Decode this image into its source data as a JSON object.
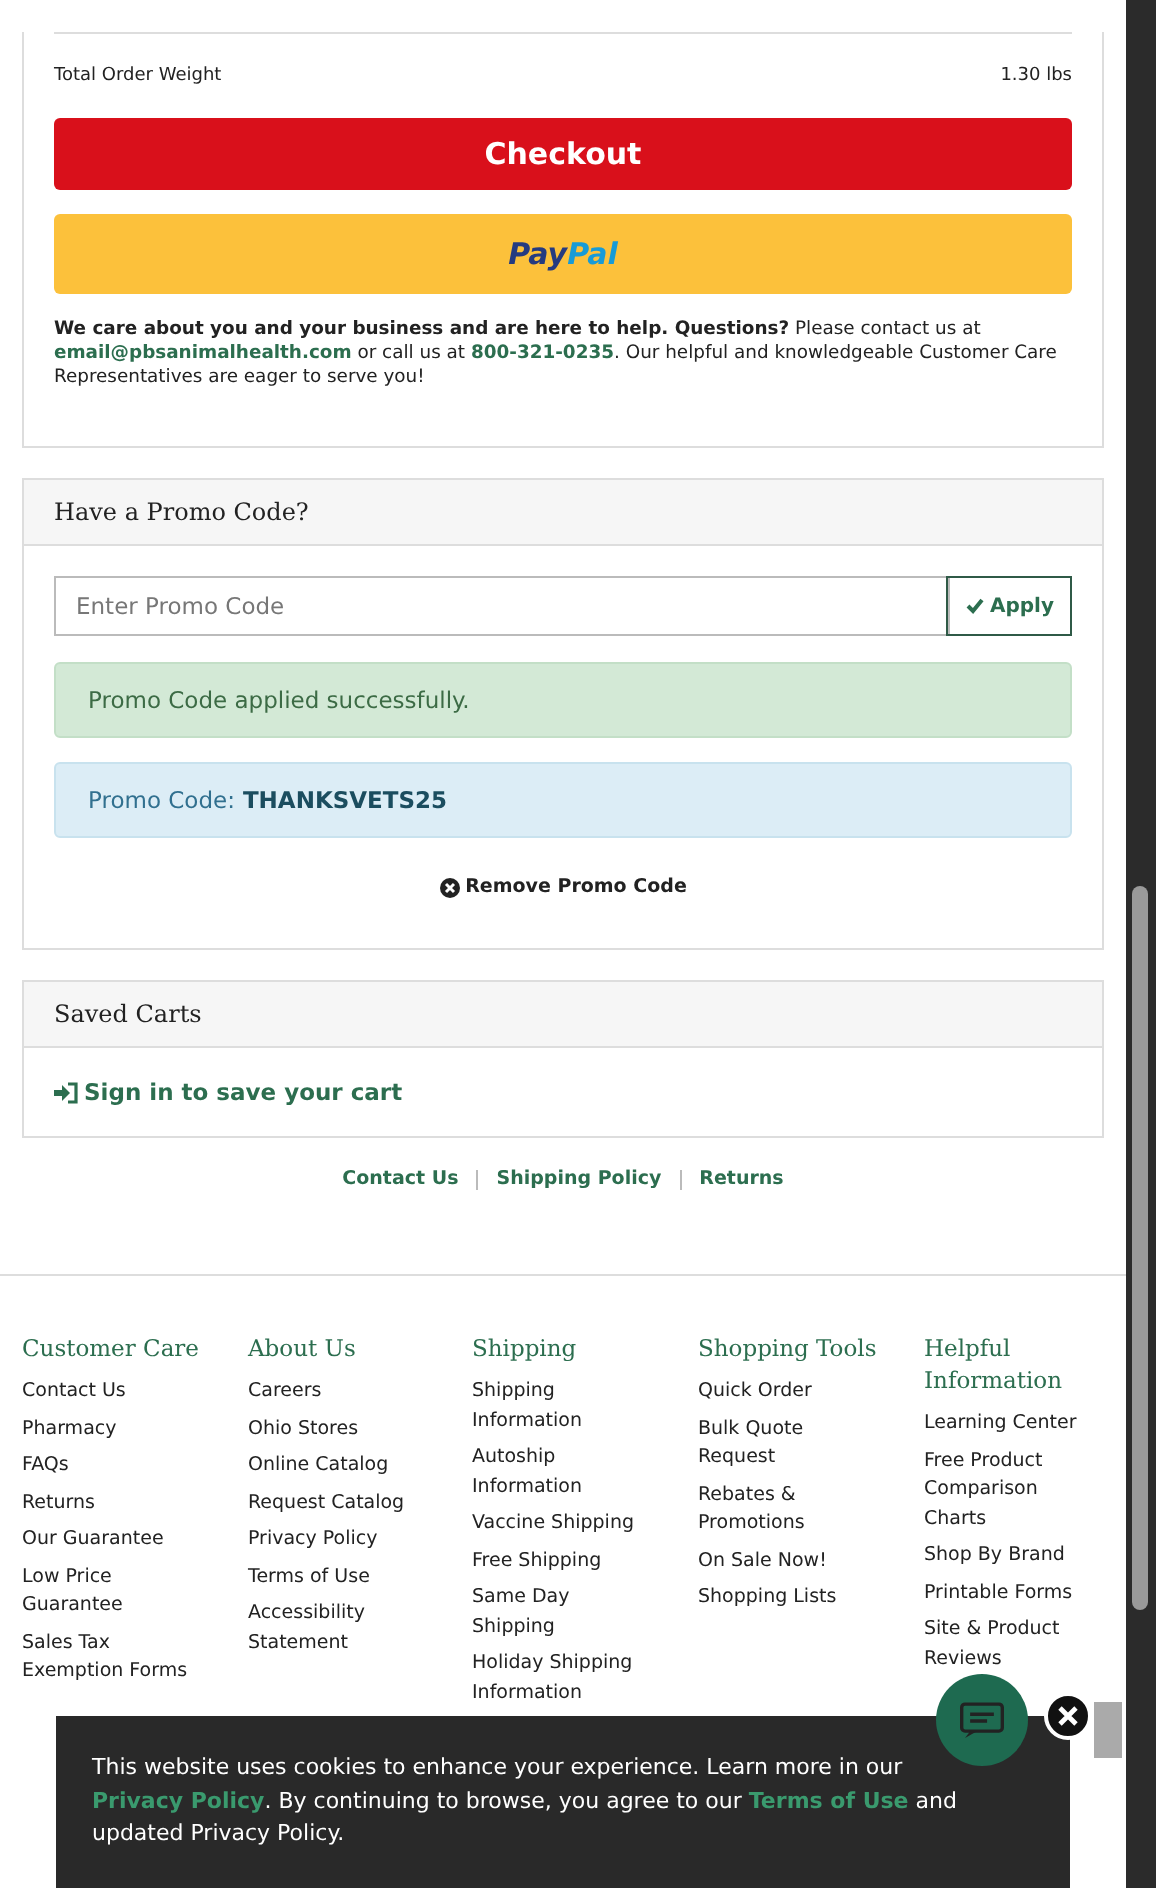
{
  "order_summary": {
    "weight_label": "Total Order Weight",
    "weight_value": "1.30 lbs",
    "checkout_button": "Checkout",
    "paypal_button": {
      "first": "Pay",
      "second": "Pal"
    },
    "help_text": "**We care about you and your business and are here to help. Questions?** Please contact us at",
    "help_email": "email@pbsanimalhealth.com",
    "help_mid": "or call us at",
    "help_phone": "800-321-0235",
    "help_tail": ". Our helpful and knowledgeable Customer Care Representatives are eager to serve you!"
  },
  "promo": {
    "title": "Have a Promo Code?",
    "placeholder": "Enter Promo Code",
    "apply_button": "Apply",
    "success_message": "Promo Code applied successfully.",
    "code_label": "Promo Code:",
    "code_value": "THANKSVETS25",
    "remove_link": "Remove Promo Code"
  },
  "saved_carts": {
    "title": "Saved Carts",
    "sign_in_link": "Sign in to save your cart"
  },
  "links": [
    "Contact Us",
    "Shipping Policy",
    "Returns"
  ],
  "footer_columns": [
    {
      "heading": "Customer Care",
      "items": [
        "Contact Us",
        "Pharmacy",
        "FAQs",
        "Returns",
        "Our Guarantee",
        "Low Price Guarantee",
        "Sales Tax Exemption Forms"
      ]
    },
    {
      "heading": "About Us",
      "items": [
        "Careers",
        "Ohio Stores",
        "Online Catalog",
        "Request Catalog",
        "Privacy Policy",
        "Terms of Use",
        "Accessibility Statement"
      ]
    },
    {
      "heading": "Shipping",
      "items": [
        "Shipping Information",
        "Autoship Information",
        "Vaccine Shipping",
        "Free Shipping",
        "Same Day Shipping",
        "Holiday Shipping Information"
      ]
    },
    {
      "heading": "Shopping Tools",
      "items": [
        "Quick Order",
        "Bulk Quote Request",
        "Rebates & Promotions",
        "On Sale Now!",
        "Shopping Lists"
      ]
    },
    {
      "heading": "Helpful Information",
      "items": [
        "Learning Center",
        "Free Product Comparison Charts",
        "Shop By Brand",
        "Printable Forms",
        "Site & Product Reviews"
      ]
    }
  ],
  "cookie_banner": {
    "text_start": "This website uses cookies to enhance your experience. Learn more in our",
    "privacy_link": "Privacy Policy",
    "text_mid": ". By continuing to browse, you agree to our",
    "terms_link": "Terms of Use",
    "text_end": "and updated Privacy Policy."
  }
}
